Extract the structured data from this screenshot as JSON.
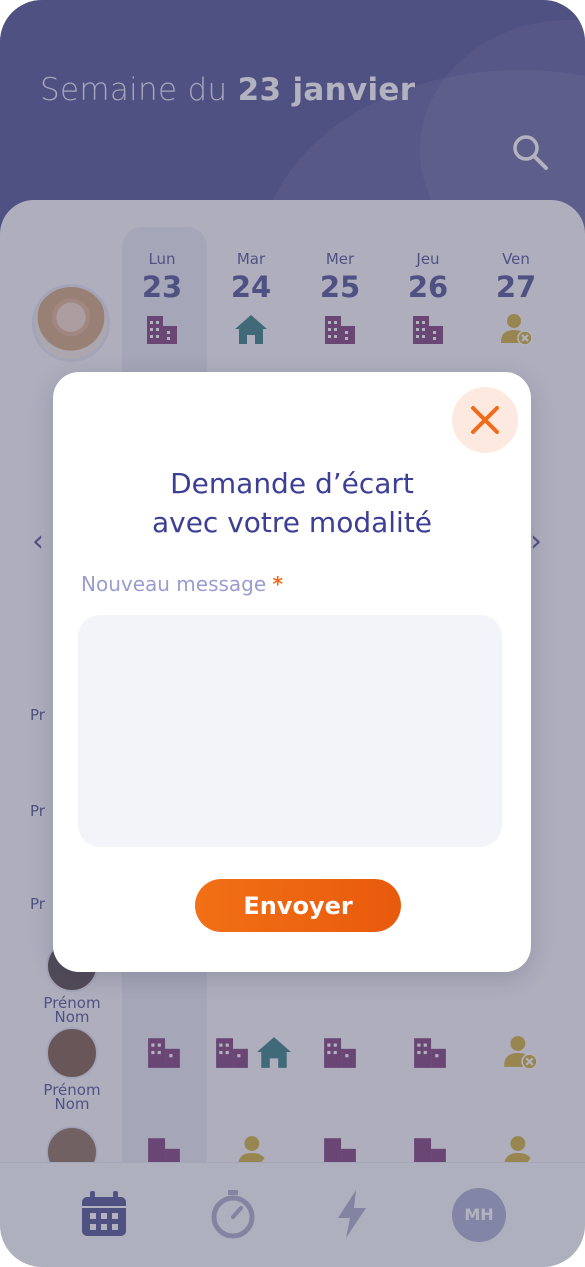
{
  "header": {
    "title_prefix": "Semaine du ",
    "title_date": "23 janvier"
  },
  "days": [
    {
      "name": "Lun",
      "num": "23",
      "icon": "building-icon"
    },
    {
      "name": "Mar",
      "num": "24",
      "icon": "home-icon"
    },
    {
      "name": "Mer",
      "num": "25",
      "icon": "building-icon"
    },
    {
      "name": "Jeu",
      "num": "26",
      "icon": "building-icon"
    },
    {
      "name": "Ven",
      "num": "27",
      "icon": "absent-person-icon"
    }
  ],
  "team": [
    {
      "first": "Prénom",
      "last": "Nom"
    },
    {
      "first": "Prénom",
      "last": "Nom"
    }
  ],
  "partial_labels": [
    "Pr",
    "Pr",
    "Pr"
  ],
  "modal": {
    "title_line1": "Demande d’écart",
    "title_line2": "avec votre modalité",
    "label": "Nouveau message",
    "required_mark": "*",
    "message_value": "",
    "send_label": "Envoyer"
  },
  "bottom_nav": {
    "profile_initials": "MH",
    "items": [
      "calendar-icon",
      "stopwatch-icon",
      "lightning-icon",
      "profile-avatar"
    ]
  },
  "colors": {
    "primary": "#383a86",
    "accent": "#ee6b1a",
    "office": "#6b2466",
    "home": "#1b6d72",
    "absent": "#c9a521"
  }
}
